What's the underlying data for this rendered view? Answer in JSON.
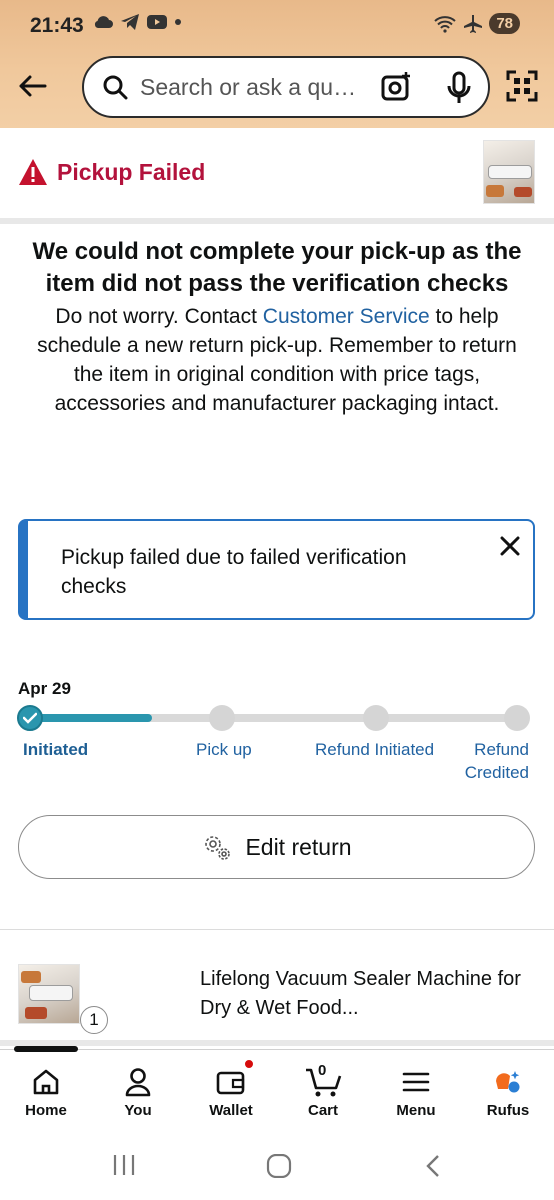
{
  "status_bar": {
    "time": "21:43",
    "battery": "78"
  },
  "search": {
    "placeholder": "Search or ask a question"
  },
  "pickup_header": {
    "label": "Pickup Failed"
  },
  "message": {
    "heading": "We could not complete your pick-up as the item did not pass the verification checks",
    "body_before_link": "Do not worry. Contact ",
    "link_text": "Customer Service",
    "body_after_link": " to help schedule a new return pick-up. Remember to return the item in original condition with price tags, accessories and manufacturer packaging intact."
  },
  "alert": {
    "text": "Pickup failed due to failed verification checks"
  },
  "progress": {
    "date": "Apr 29",
    "completed_fraction": 0.25,
    "steps": [
      {
        "label": "Initiated",
        "line2": "",
        "state": "done"
      },
      {
        "label": "Pick up",
        "line2": "",
        "state": "pending"
      },
      {
        "label": "Refund Initiated",
        "line2": "",
        "state": "pending"
      },
      {
        "label": "Refund",
        "line2": "Credited",
        "state": "pending"
      }
    ]
  },
  "edit_return": {
    "label": "Edit return"
  },
  "item": {
    "title": "Lifelong Vacuum Sealer Machine for Dry & Wet Food...",
    "quantity": "1"
  },
  "bottom_nav": {
    "items": [
      {
        "label": "Home",
        "icon": "home-icon"
      },
      {
        "label": "You",
        "icon": "person-icon"
      },
      {
        "label": "Wallet",
        "icon": "wallet-icon"
      },
      {
        "label": "Cart",
        "icon": "cart-icon"
      },
      {
        "label": "Menu",
        "icon": "menu-icon"
      },
      {
        "label": "Rufus",
        "icon": "rufus-icon"
      }
    ],
    "cart_count": "0"
  },
  "colors": {
    "accent_blue": "#2773c3",
    "error_red": "#b3123c",
    "progress_teal": "#2a96ae",
    "header_tan": "#f0c89c"
  }
}
